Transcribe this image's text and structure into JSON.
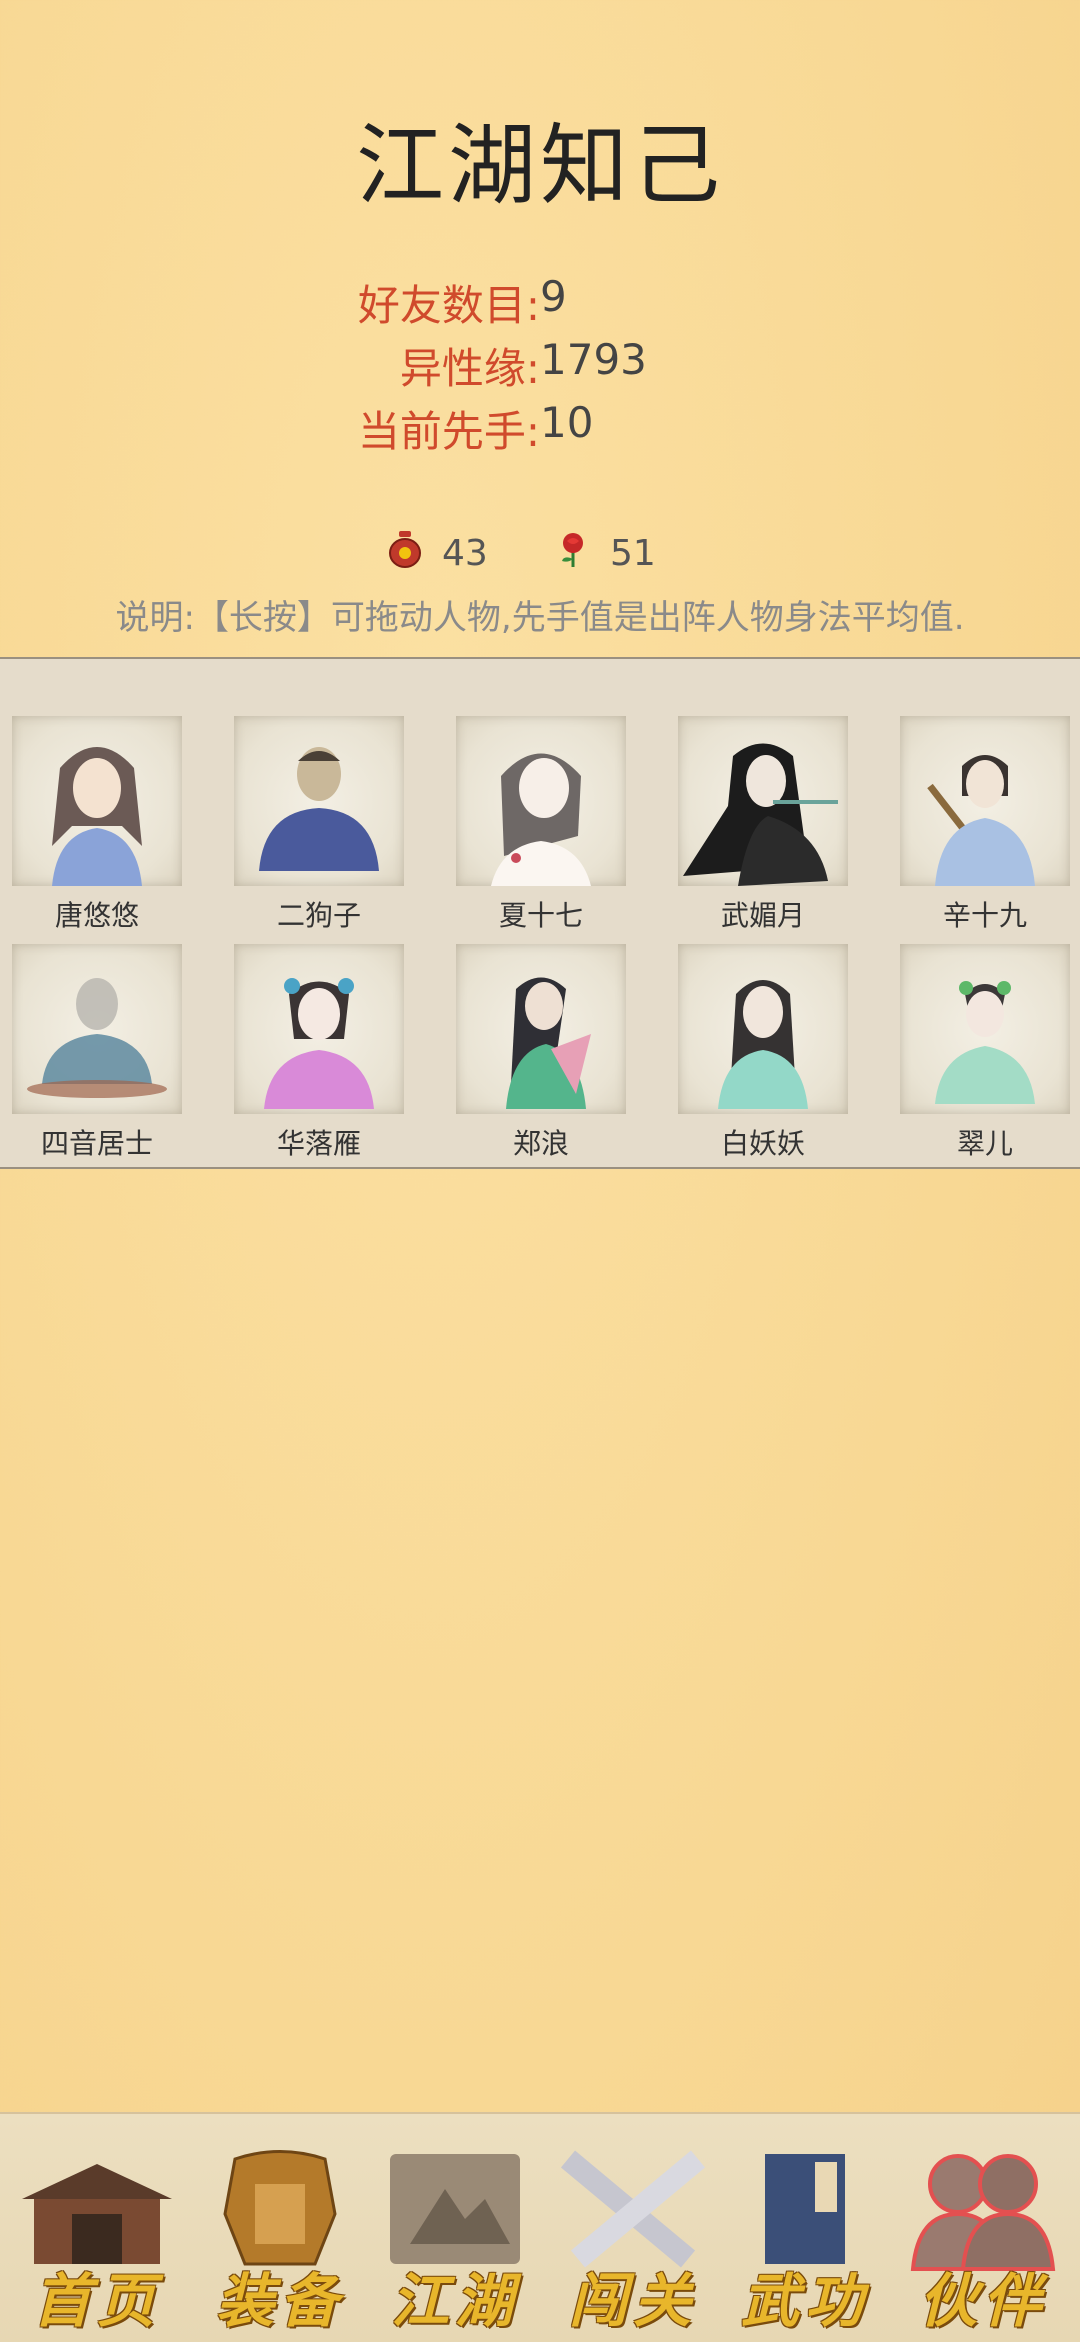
{
  "page": {
    "title": "江湖知己"
  },
  "stats": [
    {
      "label": "好友数目:",
      "value": "9"
    },
    {
      "label": "异性缘:",
      "value": "1793"
    },
    {
      "label": "当前先手:",
      "value": "10"
    }
  ],
  "currency": {
    "jar_count": "43",
    "rose_count": "51"
  },
  "note": "说明:【长按】可拖动人物,先手值是出阵人物身法平均值.",
  "characters": [
    {
      "name": "唐悠悠"
    },
    {
      "name": "二狗子"
    },
    {
      "name": "夏十七"
    },
    {
      "name": "武媚月"
    },
    {
      "name": "辛十九"
    },
    {
      "name": "四音居士"
    },
    {
      "name": "华落雁"
    },
    {
      "name": "郑浪"
    },
    {
      "name": "白妖妖"
    },
    {
      "name": "翠儿"
    }
  ],
  "nav": [
    {
      "label": "首页",
      "icon": "house-icon"
    },
    {
      "label": "装备",
      "icon": "armor-icon"
    },
    {
      "label": "江湖",
      "icon": "scroll-icon"
    },
    {
      "label": "闯关",
      "icon": "crossed-swords-icon"
    },
    {
      "label": "武功",
      "icon": "book-icon"
    },
    {
      "label": "伙伴",
      "icon": "partners-icon",
      "active": true
    }
  ]
}
